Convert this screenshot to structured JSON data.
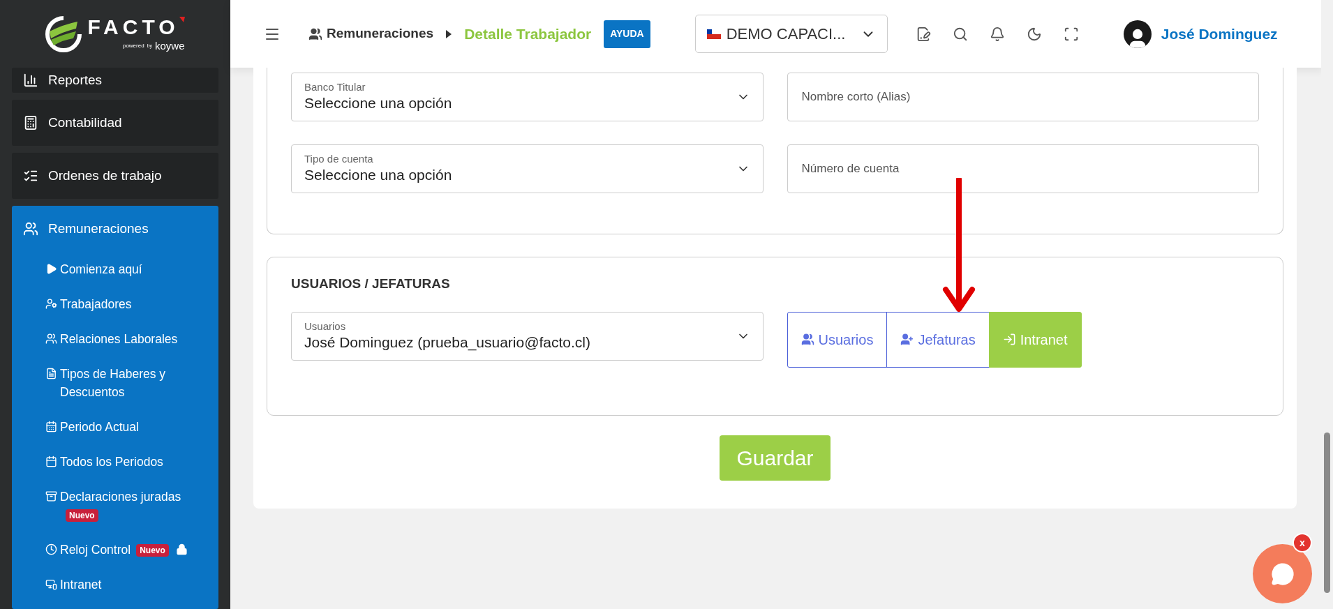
{
  "logo": {
    "name": "FACTO",
    "powered": "powered",
    "by": "by",
    "brand": "koywe"
  },
  "sidebar": {
    "items": [
      {
        "label": "Reportes",
        "expanded": false
      },
      {
        "label": "Contabilidad",
        "expanded": false
      },
      {
        "label": "Ordenes de trabajo",
        "expanded": false
      },
      {
        "label": "Remuneraciones",
        "expanded": true,
        "children": [
          {
            "label": "Comienza aquí"
          },
          {
            "label": "Trabajadores"
          },
          {
            "label": "Relaciones Laborales"
          },
          {
            "label": "Tipos de Haberes y Descuentos"
          },
          {
            "label": "Periodo Actual"
          },
          {
            "label": "Todos los Periodos"
          },
          {
            "label": "Declaraciones juradas",
            "badge": "Nuevo",
            "locked": false
          },
          {
            "label": "Reloj Control",
            "badge": "Nuevo",
            "locked": true
          },
          {
            "label": "Intranet"
          }
        ]
      }
    ]
  },
  "header": {
    "breadcrumb": [
      {
        "label": "Remuneraciones",
        "selected": false
      },
      {
        "label": "Detalle Trabajador",
        "selected": true
      }
    ],
    "help_button": "AYUDA",
    "company": "DEMO CAPACI...",
    "user": "José Dominguez"
  },
  "bank_section": {
    "fields": [
      {
        "kind": "select",
        "label": "Banco Titular",
        "value": "Seleccione una opción"
      },
      {
        "kind": "input",
        "placeholder": "Nombre corto (Alias)"
      },
      {
        "kind": "select",
        "label": "Tipo de cuenta",
        "value": "Seleccione una opción"
      },
      {
        "kind": "input",
        "placeholder": "Número de cuenta"
      }
    ]
  },
  "users_section": {
    "title": "USUARIOS / JEFATURAS",
    "select": {
      "label": "Usuarios",
      "value": "José Dominguez (prueba_usuario@facto.cl)"
    },
    "buttons": [
      {
        "label": "Usuarios",
        "kind": "outline"
      },
      {
        "label": "Jefaturas",
        "kind": "outline"
      },
      {
        "label": "Intranet",
        "kind": "solid"
      }
    ]
  },
  "save_button": "Guardar",
  "chat": {
    "close": "x"
  }
}
